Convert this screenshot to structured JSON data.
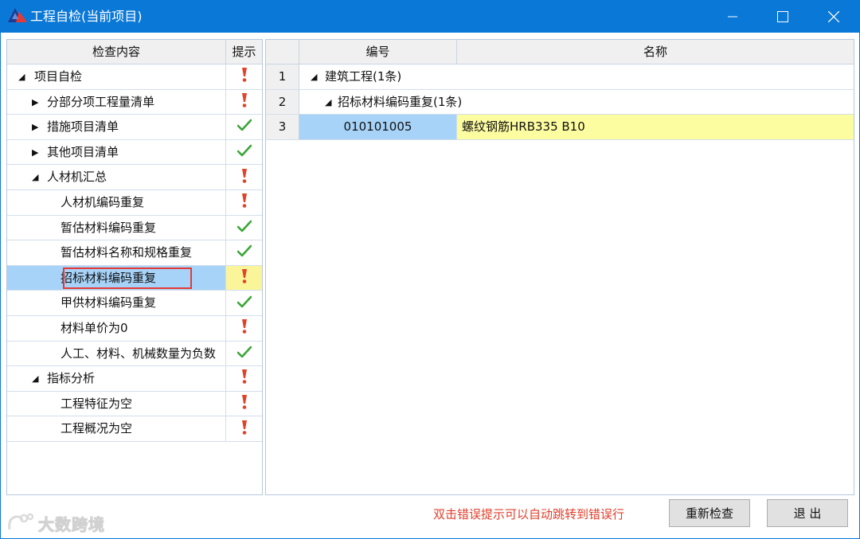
{
  "window": {
    "title": "工程自检(当前项目)",
    "accent": "#0a78d7"
  },
  "left": {
    "header_content": "检查内容",
    "header_hint": "提示",
    "rows": [
      {
        "label": "项目自检",
        "level": 0,
        "expander": "expanded",
        "status": "warning"
      },
      {
        "label": "分部分项工程量清单",
        "level": 1,
        "expander": "collapsed",
        "status": "warning"
      },
      {
        "label": "措施项目清单",
        "level": 1,
        "expander": "collapsed",
        "status": "ok"
      },
      {
        "label": "其他项目清单",
        "level": 1,
        "expander": "collapsed",
        "status": "ok"
      },
      {
        "label": "人材机汇总",
        "level": 1,
        "expander": "expanded",
        "status": "warning"
      },
      {
        "label": "人材机编码重复",
        "level": 2,
        "expander": "none",
        "status": "warning"
      },
      {
        "label": "暂估材料编码重复",
        "level": 2,
        "expander": "none",
        "status": "ok"
      },
      {
        "label": "暂估材料名称和规格重复",
        "level": 2,
        "expander": "none",
        "status": "ok"
      },
      {
        "label": "招标材料编码重复",
        "level": 2,
        "expander": "none",
        "status": "warning",
        "selected": true
      },
      {
        "label": "甲供材料编码重复",
        "level": 2,
        "expander": "none",
        "status": "ok"
      },
      {
        "label": "材料单价为0",
        "level": 2,
        "expander": "none",
        "status": "warning"
      },
      {
        "label": "人工、材料、机械数量为负数",
        "level": 2,
        "expander": "none",
        "status": "ok"
      },
      {
        "label": "指标分析",
        "level": 1,
        "expander": "expanded",
        "status": "warning"
      },
      {
        "label": "工程特征为空",
        "level": 2,
        "expander": "none",
        "status": "warning"
      },
      {
        "label": "工程概况为空",
        "level": 2,
        "expander": "none",
        "status": "warning"
      }
    ]
  },
  "right": {
    "header_code": "编号",
    "header_name": "名称",
    "rows": [
      {
        "num": "1",
        "group": "建筑工程(1条)",
        "level": 0
      },
      {
        "num": "2",
        "group": "招标材料编码重复(1条)",
        "level": 1
      },
      {
        "num": "3",
        "code": "010101005",
        "name": "螺纹钢筋HRB335 B10"
      }
    ]
  },
  "footer": {
    "hint": "双击错误提示可以自动跳转到错误行",
    "recheck_label": "重新检查",
    "exit_label": "退 出",
    "watermark": "大数跨境"
  },
  "colors": {
    "warning_icon": "#e0432a",
    "ok_icon": "#3aa637",
    "selected_row": "#a7d3f8",
    "highlight_yellow": "#fcfca0",
    "hint_text": "#e0402d"
  }
}
